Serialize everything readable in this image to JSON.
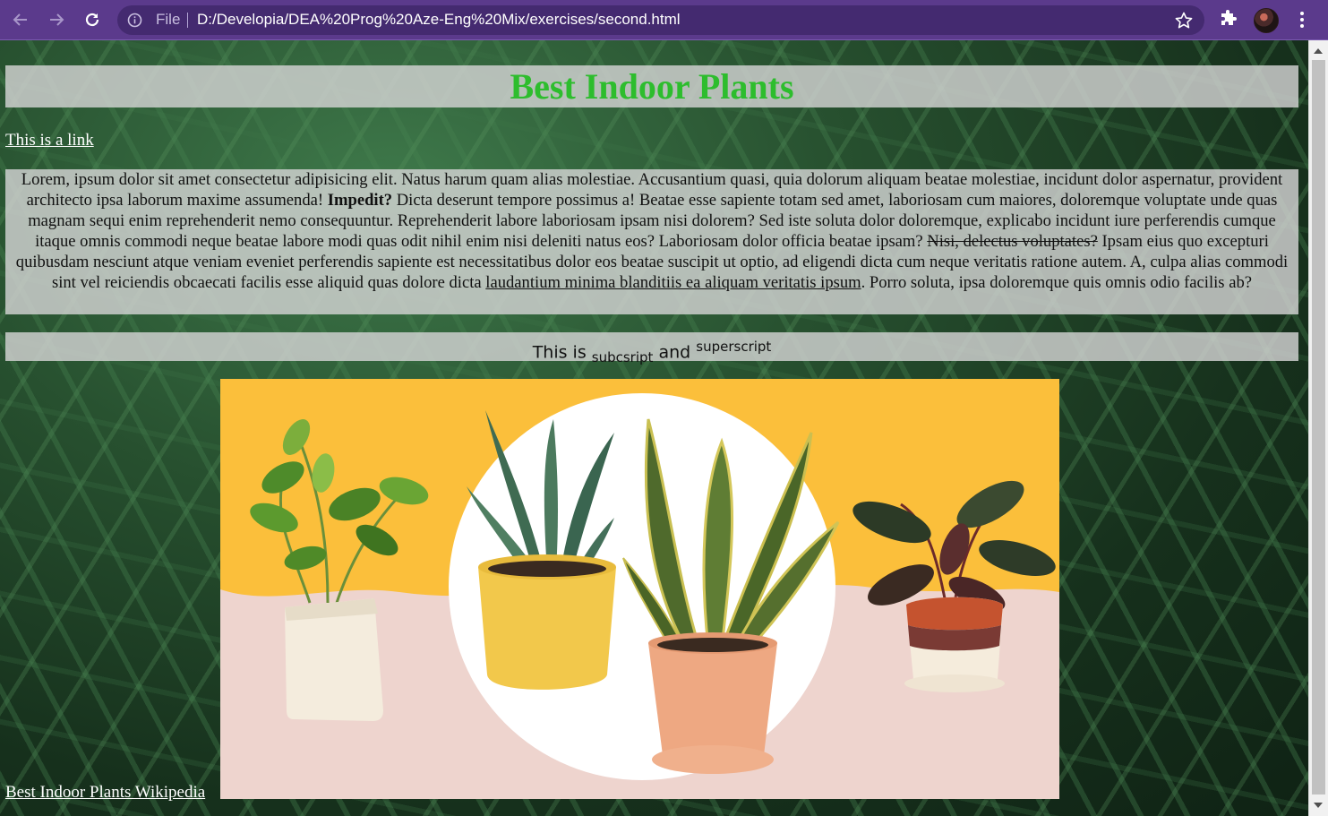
{
  "browser": {
    "file_label": "File",
    "url": "D:/Developia/DEA%20Prog%20Aze-Eng%20Mix/exercises/second.html"
  },
  "page": {
    "heading": "Best Indoor Plants",
    "top_link": "This is a link",
    "paragraph": {
      "part1": "Lorem, ipsum dolor sit amet consectetur adipisicing elit. Natus harum quam alias molestiae. Accusantium quasi, quia dolorum aliquam beatae molestiae, incidunt dolor aspernatur, provident architecto ipsa laborum maxime assumenda! ",
      "bold": "Impedit?",
      "part2": " Dicta deserunt tempore possimus a! Beatae esse sapiente totam sed amet, laboriosam cum maiores, doloremque voluptate unde quas magnam sequi enim reprehenderit nemo consequuntur. Reprehenderit labore laboriosam ipsam nisi dolorem? Sed iste soluta dolor doloremque, explicabo incidunt iure perferendis cumque itaque omnis commodi neque beatae labore modi quas odit nihil enim nisi deleniti natus eos? Laboriosam dolor officia beatae ipsam? ",
      "strike": "Nisi, delectus voluptates?",
      "part3": " Ipsam eius quo excepturi quibusdam nesciunt atque veniam eveniet perferendis sapiente est necessitatibus dolor eos beatae suscipit ut optio, ad eligendi dicta cum neque veritatis ratione autem. A, culpa alias commodi sint vel reiciendis obcaecati facilis esse aliquid quas dolore dicta ",
      "underline": "laudantium minima blanditiis ea aliquam veritatis ipsum",
      "part4": ". Porro soluta, ipsa doloremque quis omnis odio facilis ab?"
    },
    "subsup": {
      "prefix": "This is ",
      "sub": "subcsript",
      "middle": " and ",
      "sup": "superscript"
    },
    "bottom_link": "Best Indoor Plants Wikipedia"
  },
  "colors": {
    "heading": "#2dbd2d",
    "chrome": "#5b3a8c",
    "box_bg": "#d3d3d3",
    "hero_yellow": "#fbbf3b",
    "hero_pink": "#eed4ce"
  },
  "icons": [
    "back-arrow-icon",
    "forward-arrow-icon",
    "reload-icon",
    "info-icon",
    "star-icon",
    "puzzle-icon",
    "kebab-menu-icon"
  ]
}
